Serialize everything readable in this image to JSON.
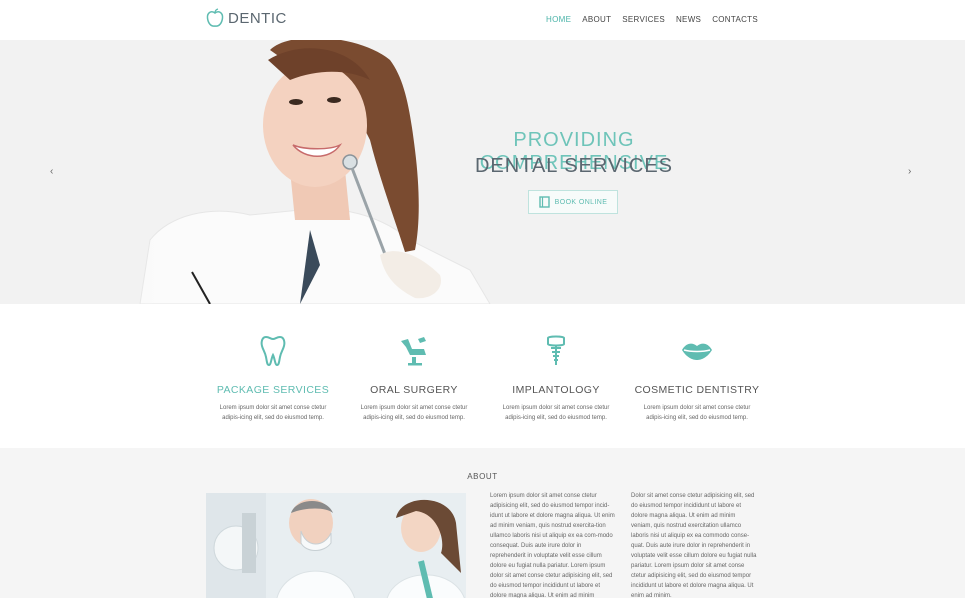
{
  "header": {
    "logo_text": "DENTIC",
    "nav": [
      "HOME",
      "ABOUT",
      "SERVICES",
      "NEWS",
      "CONTACTS"
    ]
  },
  "hero": {
    "title_line1": "PROVIDING COMPREHENSIVE",
    "title_line2": "DENTAL SERVICES",
    "cta_label": "BOOK ONLINE",
    "prev_arrow": "‹",
    "next_arrow": "›"
  },
  "services": [
    {
      "icon": "tooth-icon",
      "title": "PACKAGE SERVICES",
      "text": "Lorem ipsum dolor sit amet conse ctetur adipis-icing elit, sed do eiusmod temp."
    },
    {
      "icon": "dental-chair-icon",
      "title": "ORAL SURGERY",
      "text": "Lorem ipsum dolor sit amet conse ctetur adipis-icing elit, sed do eiusmod temp."
    },
    {
      "icon": "implant-icon",
      "title": "IMPLANTOLOGY",
      "text": "Lorem ipsum dolor sit amet conse ctetur adipis-icing elit, sed do eiusmod temp."
    },
    {
      "icon": "lips-icon",
      "title": "COSMETIC DENTISTRY",
      "text": "Lorem ipsum dolor sit amet conse ctetur adipis-icing elit, sed do eiusmod temp."
    }
  ],
  "about": {
    "title": "ABOUT",
    "col1": "Lorem ipsum dolor sit amet conse ctetur adipisicing elit, sed do eiusmod tempor incid-idunt ut labore et dolore magna aliqua. Ut enim ad minim veniam, quis nostrud exercita-tion ullamco laboris nisi ut aliquip ex ea com-modo consequat. Duis aute irure dolor in reprehenderit in voluptate velit esse cillum dolore eu fugiat nulla pariatur. Lorem ipsum dolor sit amet conse ctetur adipisicing elit, sed do eiusmod tempor incididunt ut labore et dolore magna aliqua. Ut enim ad minim",
    "col2": "Dolor sit amet conse ctetur adipisicing elit, sed do eiusmod tempor incididunt ut labore et dolore magna aliqua. Ut enim ad minim veniam, quis nostrud exercitation ullamco laboris nisi ut aliquip ex ea commodo conse-quat. Duis aute irure dolor in reprehenderit in voluptate velit esse cillum dolore eu fugiat nulla pariatur. Lorem ipsum dolor sit amet conse ctetur adipisicing elit, sed do eiusmod tempor incididunt ut labore et dolore magna aliqua. Ut enim ad minim."
  },
  "colors": {
    "accent": "#5fbcb1",
    "text_dark": "#5b6770",
    "hero_bg": "#f2f2f2",
    "about_bg": "#f5f5f5"
  }
}
